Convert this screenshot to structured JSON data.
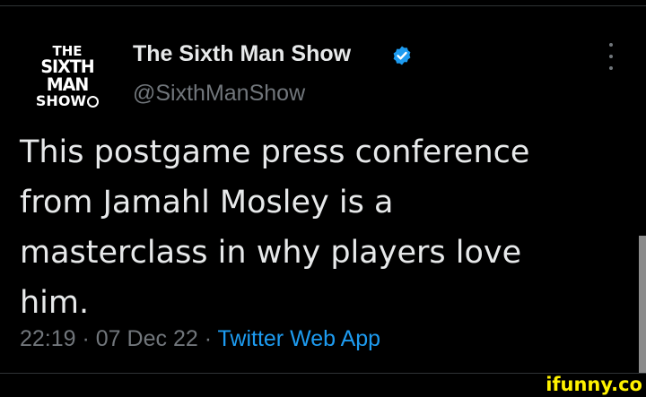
{
  "tweet": {
    "author": {
      "avatar_text": [
        "THE",
        "SIXTH MAN",
        "SHOW"
      ],
      "display_name": "The Sixth Man Show",
      "handle": "@SixthManShow",
      "verified_icon": "verified-badge-icon",
      "verified_color": "#1d9bf0"
    },
    "more_icon": "more-vertical-icon",
    "text_lines": [
      "This postgame press conference",
      "from Jamahl Mosley is a",
      "masterclass in why players love",
      "him."
    ],
    "time": "22:19",
    "separator": " · ",
    "date": "07 Dec 22",
    "source": "Twitter Web App",
    "source_color": "#1d9bf0"
  },
  "watermark": "ifunny.co"
}
